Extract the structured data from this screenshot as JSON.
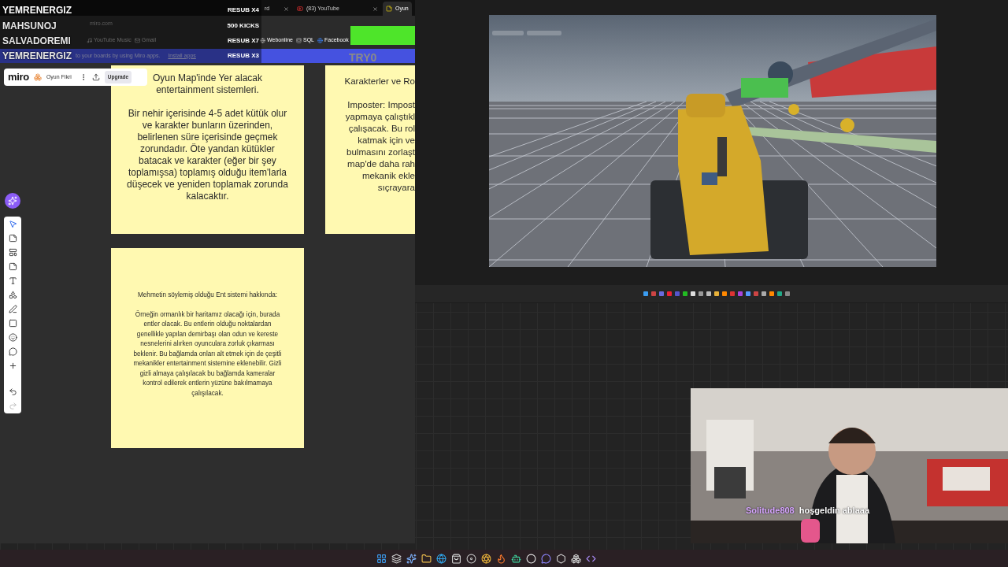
{
  "alerts": [
    {
      "name": "YEMRENERGIZ",
      "event": "RESUB X4"
    },
    {
      "name": "MAHSUNOJ",
      "event": "500 KICKS"
    },
    {
      "name": "SALVADOREMI",
      "event": "RESUB X7"
    },
    {
      "name": "YEMRENERGIZ",
      "event": "RESUB X3"
    }
  ],
  "browser": {
    "tabs": [
      {
        "label": "rd",
        "selected": false
      },
      {
        "label": "(83) YouTube",
        "selected": false
      },
      {
        "label": "Oyun",
        "selected": true
      }
    ],
    "url": "miro.com",
    "bookmarks": [
      "YouTube Music",
      "Gmail",
      "Webonline",
      "SQL",
      "Facebook"
    ],
    "banner": {
      "text": "to your boards by using Miro apps.",
      "link": "Install apps"
    }
  },
  "goal": {
    "label": "TRY0",
    "level": 1
  },
  "miro": {
    "logo": "miro",
    "board": "Oyun Fikri",
    "upgrade": "Upgrade"
  },
  "stickies": [
    {
      "kind": "large",
      "paragraphs": [
        "Oyun Map'inde Yer alacak\nentertainment sistemleri.",
        "Bir nehir içerisinde 4-5 adet kütük olur\nve karakter bunların üzerinden,\nbelirlenen süre içerisinde geçmek\nzorundadır. Öte yandan kütükler\nbatacak ve karakter (eğer bir şey\ntoplamışsa) toplamış olduğu item'larla\ndüşecek ve yeniden toplamak zorunda\nkalacaktır."
      ]
    },
    {
      "kind": "cut",
      "paragraphs": [
        "Karakterler ve Ro",
        "Imposter: Impost\nyapmaya çalıştıkl\nçalışacak. Bu rol\nkatmak için ve\nbulmasını zorlaşt\nmap'de daha rah\nmekanik ekle\nsıçrayara"
      ]
    },
    {
      "kind": "small",
      "paragraphs": [
        "Mehmetin söylemiş olduğu Ent sistemi hakkında:",
        "Örneğin ormanlık bir haritamız olacağı için, burada\nentler olacak. Bu entlerin olduğu noktalardan\ngenellikle yapılan demirbaşı olan odun ve kereste\nnesnelerini alırken oyunculara zorluk çıkarması\nbeklenir. Bu bağlamda onları alt etmek için de çeşitli\nmekanikler entertainment sistemine eklenebilir. Gizli\ngizli almaya çalışılacak bu bağlamda kameralar\nkontrol edilerek entlerin yüzüne bakılmamaya\nçalışılacak."
      ]
    }
  ],
  "chat": {
    "user": "Solitude808",
    "message": "hoşgeldin ablaaa"
  }
}
